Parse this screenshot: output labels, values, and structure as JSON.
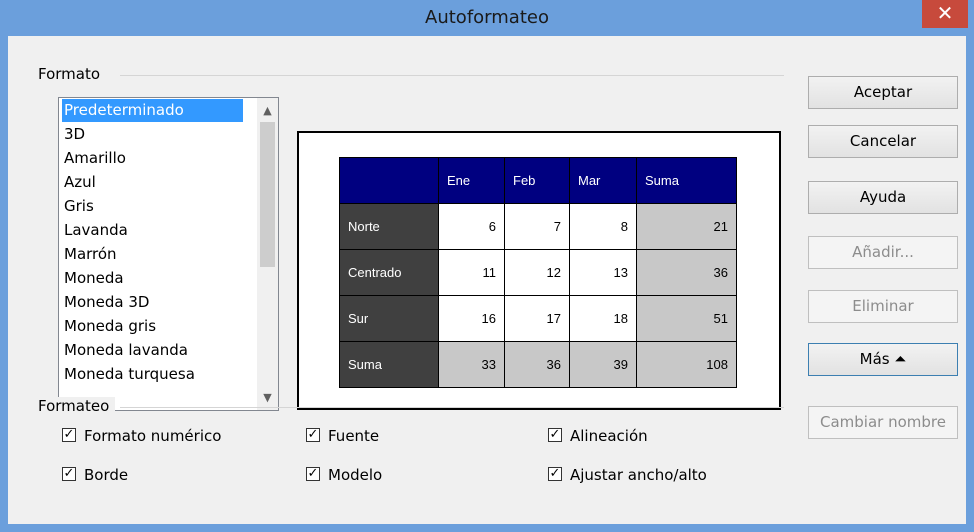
{
  "window": {
    "title": "Autoformateo",
    "close_glyph": "✕"
  },
  "format_group": {
    "label": "Formato"
  },
  "formats": [
    "Predeterminado",
    "3D",
    "Amarillo",
    "Azul",
    "Gris",
    "Lavanda",
    "Marrón",
    "Moneda",
    "Moneda 3D",
    "Moneda gris",
    "Moneda lavanda",
    "Moneda turquesa"
  ],
  "selected_format": "Predeterminado",
  "preview": {
    "columns": [
      "Ene",
      "Feb",
      "Mar",
      "Suma"
    ],
    "rows": [
      {
        "label": "Norte",
        "values": [
          "6",
          "7",
          "8",
          "21"
        ]
      },
      {
        "label": "Centrado",
        "values": [
          "11",
          "12",
          "13",
          "36"
        ]
      },
      {
        "label": "Sur",
        "values": [
          "16",
          "17",
          "18",
          "51"
        ]
      },
      {
        "label": "Suma",
        "values": [
          "33",
          "36",
          "39",
          "108"
        ]
      }
    ]
  },
  "buttons": {
    "accept": "Aceptar",
    "cancel": "Cancelar",
    "help": "Ayuda",
    "add": "Añadir...",
    "delete": "Eliminar",
    "more": "Más",
    "more_glyph": "⏶",
    "rename": "Cambiar nombre"
  },
  "formatting_group": {
    "label": "Formateo"
  },
  "options": [
    {
      "label": "Formato numérico",
      "checked": true
    },
    {
      "label": "Fuente",
      "checked": true
    },
    {
      "label": "Alineación",
      "checked": true
    },
    {
      "label": "Borde",
      "checked": true
    },
    {
      "label": "Modelo",
      "checked": true
    },
    {
      "label": "Ajustar ancho/alto",
      "checked": true
    }
  ],
  "check_glyph": "✓"
}
